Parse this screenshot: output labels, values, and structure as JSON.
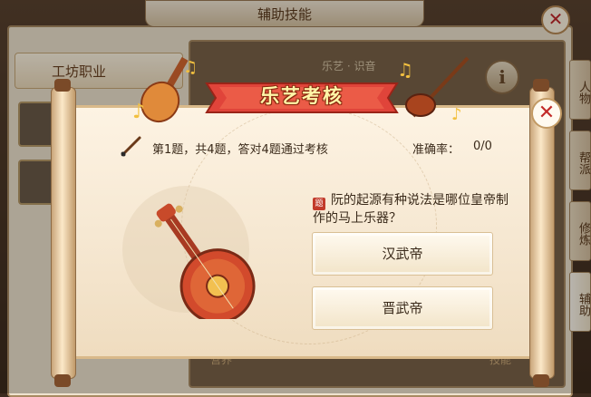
{
  "background": {
    "window_title": "辅助技能",
    "left_panel_header": "工坊职业",
    "panel_subtitle": "乐艺 · 识音",
    "bottom_left_label": "营养",
    "bottom_right_label": "技能",
    "side_tabs": [
      "人物",
      "帮派",
      "修炼",
      "辅助"
    ],
    "close_icon": "✕",
    "info_icon": "i"
  },
  "dialog": {
    "title": "乐艺考核",
    "progress_text": "第1题，共4题，答对4题通过考核",
    "accuracy_label": "准确率：",
    "accuracy_value": "0/0",
    "question": "阮的起源有种说法是哪位皇帝制作的马上乐器？",
    "question_badge": "题",
    "answers": [
      "汉武帝",
      "晋武帝"
    ],
    "close_icon": "✕"
  },
  "colors": {
    "banner_red": "#e0443a",
    "title_yellow": "#fff6a8",
    "close_red": "#c22a28"
  }
}
